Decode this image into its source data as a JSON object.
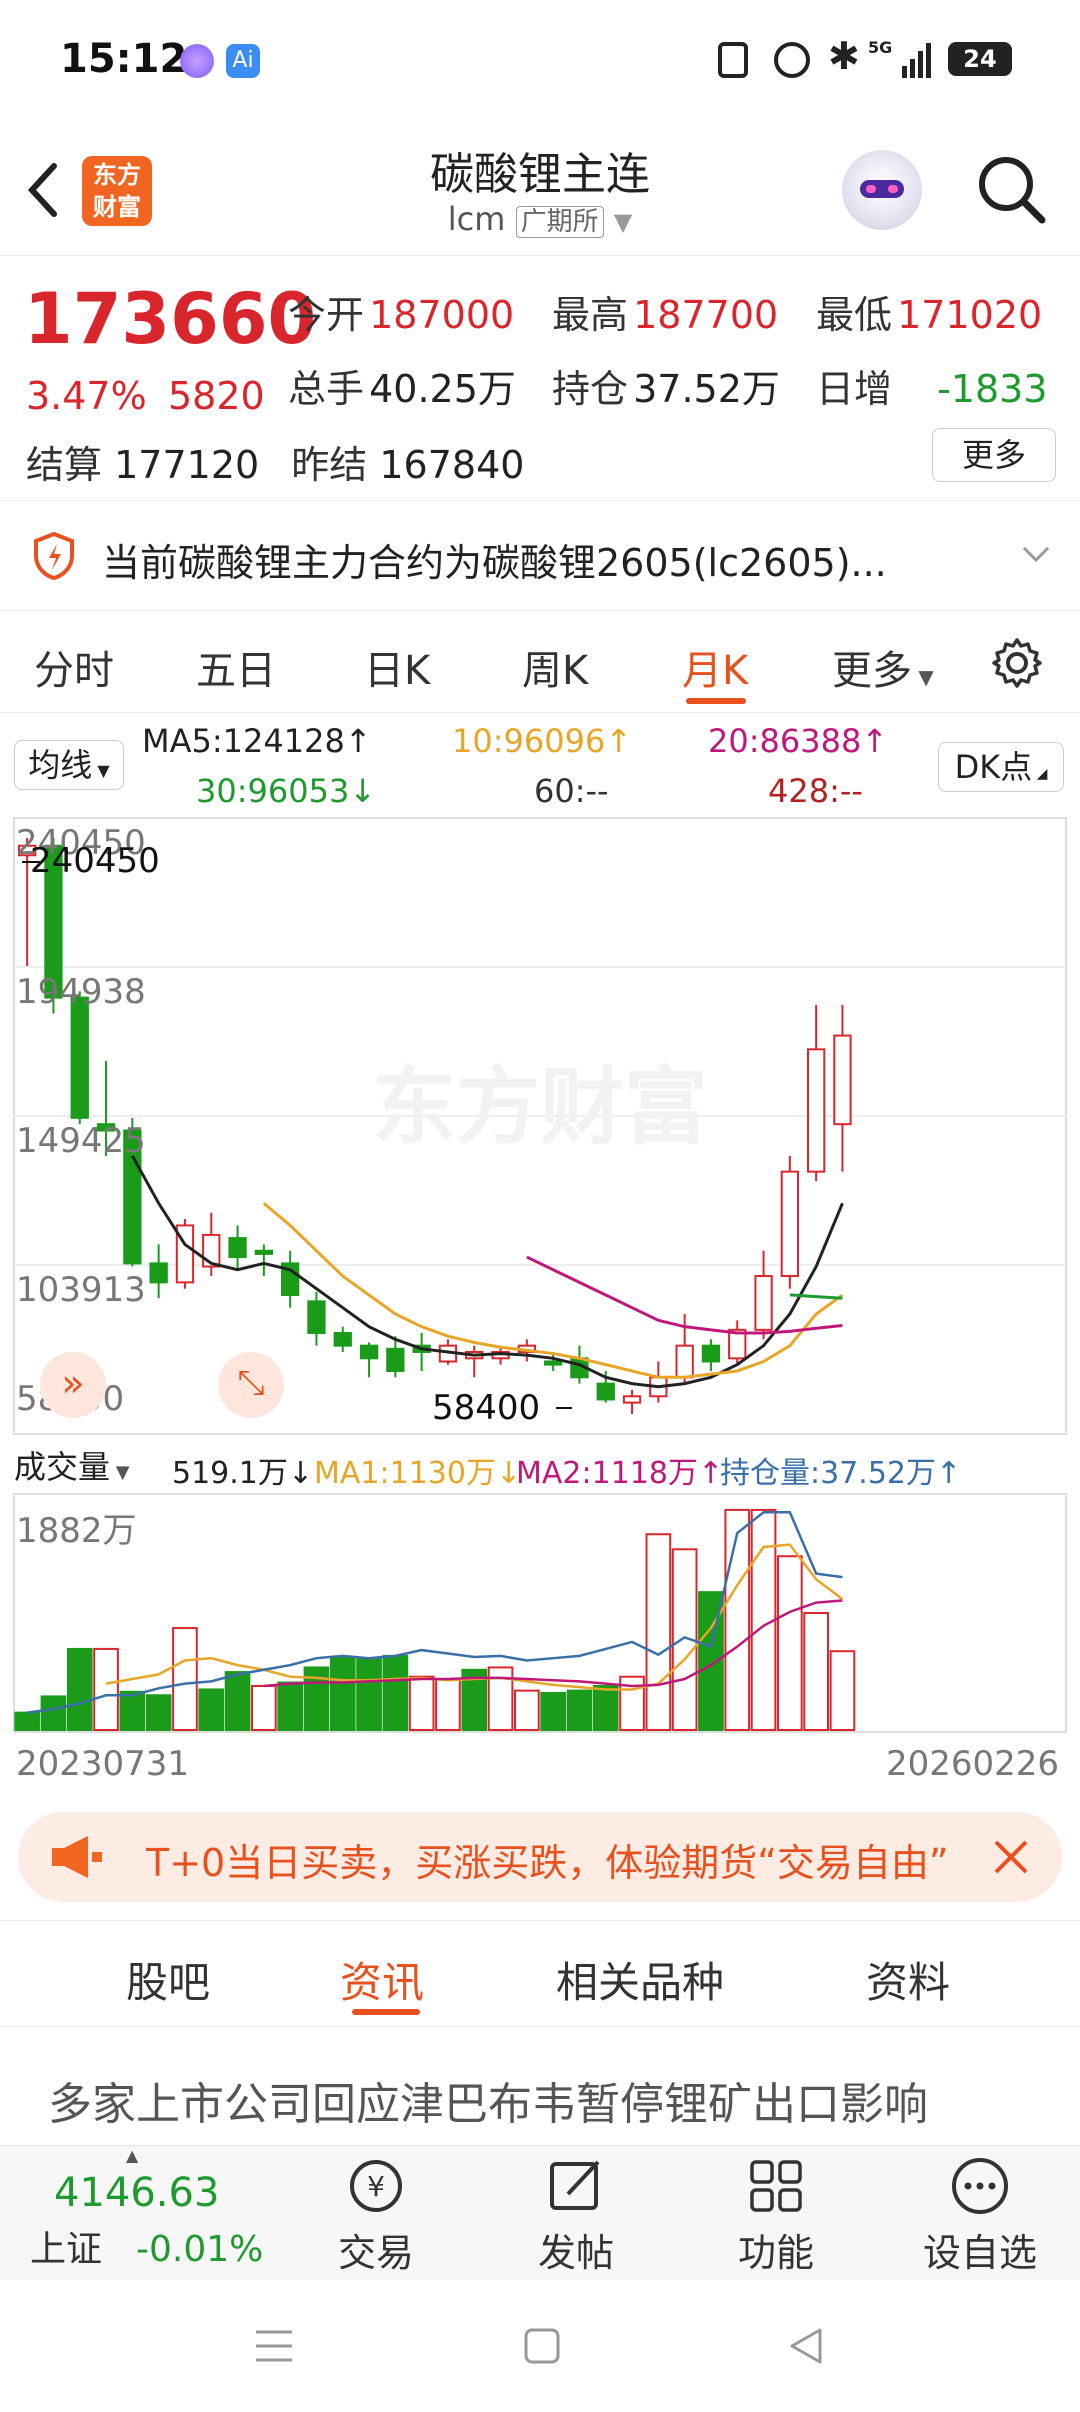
{
  "status": {
    "time": "15:12",
    "network": "5G",
    "battery": "24"
  },
  "header": {
    "title": "碳酸锂主连",
    "code": "lcm",
    "exchange": "广期所",
    "logo_line1": "东方",
    "logo_line2": "财富"
  },
  "quote": {
    "price": "173660",
    "change_pct": "3.47%",
    "change": "5820",
    "open_label": "今开",
    "open": "187000",
    "high_label": "最高",
    "high": "187700",
    "low_label": "最低",
    "low": "171020",
    "volume_label": "总手",
    "volume": "40.25万",
    "oi_label": "持仓",
    "oi": "37.52万",
    "daily_label": "日增",
    "daily": "-1833",
    "settle_label": "结算",
    "settle": "177120",
    "prev_label": "昨结",
    "prev": "167840",
    "more_label": "更多"
  },
  "notice": {
    "text": "当前碳酸锂主力合约为碳酸锂2605(lc2605)..."
  },
  "tabs": [
    "分时",
    "五日",
    "日K",
    "周K",
    "月K",
    "更多"
  ],
  "active_tab": "月K",
  "ma": {
    "selector": "均线",
    "ma5": "MA5:124128↑",
    "ma10": "10:96096↑",
    "ma20": "20:86388↑",
    "ma30": "30:96053↓",
    "ma60": "60:--",
    "ma428": "428:--",
    "dk_button": "DK点",
    "colors": {
      "ma5": "#222222",
      "ma10": "#e8a628",
      "ma20": "#c0187a",
      "ma30": "#1f9a2e",
      "ma428": "#b22222"
    }
  },
  "chart_data": {
    "type": "candlestick",
    "y_top_label": "240450",
    "y_labels": [
      "240450",
      "194938",
      "149425",
      "103913",
      "58400"
    ],
    "high_marker": "240450",
    "low_marker": "58400",
    "ylim": [
      58400,
      240450
    ],
    "candles": [
      [
        235000,
        240450,
        200000,
        238000
      ],
      [
        238000,
        240450,
        185000,
        190000
      ],
      [
        190000,
        192000,
        150000,
        152000
      ],
      [
        150000,
        170000,
        140000,
        148000
      ],
      [
        148000,
        152000,
        105000,
        106000
      ],
      [
        106000,
        112000,
        95000,
        100000
      ],
      [
        100000,
        120000,
        98000,
        118000
      ],
      [
        105000,
        122000,
        102000,
        115000
      ],
      [
        114000,
        118000,
        104000,
        108000
      ],
      [
        110000,
        112000,
        102000,
        109000
      ],
      [
        106000,
        110000,
        92000,
        96000
      ],
      [
        94000,
        97000,
        80000,
        84000
      ],
      [
        84000,
        86000,
        78000,
        80000
      ],
      [
        80000,
        81000,
        70000,
        76000
      ],
      [
        79000,
        83000,
        70000,
        72000
      ],
      [
        80000,
        84000,
        72000,
        78000
      ],
      [
        75000,
        82000,
        74000,
        80000
      ],
      [
        76000,
        80000,
        70000,
        78000
      ],
      [
        76000,
        80000,
        74000,
        78000
      ],
      [
        78000,
        82000,
        75000,
        80000
      ],
      [
        75000,
        78000,
        72000,
        74000
      ],
      [
        76000,
        80000,
        68000,
        70000
      ],
      [
        68000,
        72000,
        62000,
        63000
      ],
      [
        62000,
        66000,
        58400,
        64000
      ],
      [
        64000,
        75000,
        62000,
        70000
      ],
      [
        70000,
        90000,
        68000,
        80000
      ],
      [
        80000,
        82000,
        72000,
        75000
      ],
      [
        76000,
        88000,
        74000,
        85000
      ],
      [
        85000,
        110000,
        82000,
        102000
      ],
      [
        102000,
        140000,
        98000,
        135000
      ],
      [
        135000,
        187700,
        132000,
        173660
      ],
      [
        150000,
        187700,
        135000,
        178000
      ]
    ],
    "bar_types": [
      "g",
      "g",
      "g",
      "h",
      "g",
      "g",
      "h",
      "g",
      "g",
      "h",
      "g",
      "g",
      "g",
      "g",
      "g",
      "h",
      "h",
      "g",
      "h",
      "h",
      "g",
      "g",
      "g",
      "h",
      "h",
      "h",
      "g",
      "h",
      "h",
      "h",
      "h",
      "h"
    ],
    "ma5_line": [
      null,
      null,
      null,
      null,
      140000,
      125000,
      112000,
      106000,
      104000,
      106000,
      104000,
      98000,
      92000,
      86000,
      82000,
      79000,
      78000,
      77000,
      77500,
      77000,
      76000,
      74000,
      70000,
      68000,
      67000,
      68000,
      70000,
      74000,
      80000,
      90000,
      105000,
      125000
    ],
    "ma10_line": [
      null,
      null,
      null,
      null,
      null,
      null,
      null,
      null,
      null,
      125000,
      118000,
      110000,
      102000,
      96000,
      90000,
      86000,
      83000,
      81000,
      79500,
      78500,
      77500,
      76000,
      74000,
      72000,
      70000,
      70000,
      71000,
      72000,
      75000,
      80000,
      90000,
      96000
    ],
    "ma20_line": [
      null,
      null,
      null,
      null,
      null,
      null,
      null,
      null,
      null,
      null,
      null,
      null,
      null,
      null,
      null,
      null,
      null,
      null,
      null,
      108000,
      104000,
      100000,
      96000,
      92000,
      88000,
      86000,
      85000,
      84000,
      84000,
      84500,
      85500,
      86388
    ],
    "ma30_line": [
      null,
      null,
      null,
      null,
      null,
      null,
      null,
      null,
      null,
      null,
      null,
      null,
      null,
      null,
      null,
      null,
      null,
      null,
      null,
      null,
      null,
      null,
      null,
      null,
      null,
      null,
      null,
      null,
      null,
      96053,
      95500,
      95000
    ],
    "volume": {
      "selector": "成交量",
      "current": "519.1万↓",
      "ma1": "MA1:1130万↓",
      "ma2": "MA2:1118万↑",
      "oi": "持仓量:37.52万↑",
      "y_max_label": "1882万",
      "ymax": 1882,
      "values": [
        150,
        290,
        700,
        700,
        330,
        300,
        880,
        350,
        500,
        380,
        410,
        540,
        620,
        610,
        640,
        460,
        440,
        520,
        540,
        340,
        320,
        340,
        380,
        460,
        1690,
        1560,
        1190,
        1900,
        1900,
        1500,
        1010,
        680
      ],
      "ma1_line": [
        null,
        null,
        null,
        400,
        440,
        480,
        600,
        620,
        560,
        520,
        460,
        450,
        430,
        430,
        440,
        450,
        430,
        440,
        450,
        420,
        390,
        370,
        350,
        350,
        400,
        610,
        880,
        1250,
        1580,
        1600,
        1300,
        1130
      ],
      "ma2_line": [
        null,
        null,
        null,
        null,
        null,
        null,
        null,
        null,
        null,
        380,
        400,
        410,
        410,
        420,
        430,
        440,
        440,
        450,
        450,
        440,
        430,
        420,
        400,
        380,
        390,
        440,
        560,
        720,
        900,
        1020,
        1100,
        1118
      ],
      "oi_line": [
        150,
        180,
        230,
        300,
        300,
        360,
        400,
        420,
        480,
        520,
        560,
        620,
        640,
        620,
        640,
        690,
        660,
        630,
        640,
        600,
        620,
        640,
        700,
        760,
        650,
        800,
        720,
        1700,
        1880,
        1880,
        1350,
        1320
      ]
    },
    "x_start": "20230731",
    "x_end": "20260226",
    "watermark": "东方财富"
  },
  "promo": {
    "text": "T+0当日买卖，买涨买跌，体验期货“交易自由”"
  },
  "news_tabs": [
    "股吧",
    "资讯",
    "相关品种",
    "资料"
  ],
  "news_active": "资讯",
  "headline": "多家上市公司回应津巴布韦暂停锂矿出口影响",
  "bottom": {
    "index_value": "4146.63",
    "index_name": "上证",
    "index_change": "-0.01%",
    "trade": "交易",
    "post": "发帖",
    "func": "功能",
    "watch": "设自选"
  }
}
